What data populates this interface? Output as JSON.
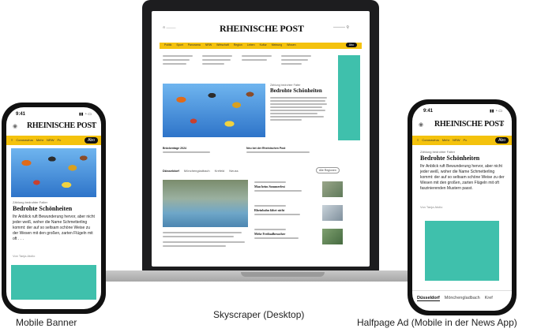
{
  "captions": {
    "left": "Mobile Banner",
    "center": "Skyscraper (Desktop)",
    "right": "Halfpage Ad (Mobile in der News App)"
  },
  "desktop": {
    "logo": "RHEINISCHE POST",
    "nav_items": [
      "Politik",
      "Sport",
      "Panorama",
      "NRW",
      "Wirtschaft",
      "Region",
      "Leben",
      "Kultur",
      "Meinung",
      "Wissen"
    ],
    "nav_pill": "Abo",
    "lead": {
      "kicker": "Zählung bedrohter Falter",
      "headline": "Bedrohte Schönheiten"
    },
    "sub_headlines": [
      "Brückentage 2024",
      "Neu bei der Rheinischen Post"
    ],
    "tabs": [
      "Düsseldorf",
      "Mönchengladbach",
      "Krefeld",
      "Neuss"
    ],
    "tab_button": "Alle Regionen",
    "news": [
      "Mau beim Sommerfest",
      "Rheinbahn fährt nicht",
      "Mehr Freibadbesucher"
    ]
  },
  "mobile_left": {
    "time": "9:41",
    "logo": "RHEINISCHE POST",
    "nav_items": [
      "Coronavirus",
      "Mehr",
      "NRW",
      "Pc"
    ],
    "nav_pill": "Abo",
    "kicker": "Zählung bedrohter Falter",
    "headline": "Bedrohte Schönheiten",
    "body": "Ihr Anblick ruft Bewunderung hervor, aber nicht jeder weiß, woher die Name Schmetterling kommt: der auf so seltsam schöne Weise zu der Wesen mit den großen, zarten Flügeln mit oft . . .",
    "author": "Von Tanja Atolio"
  },
  "mobile_right": {
    "time": "9:41",
    "logo": "RHEINISCHE POST",
    "nav_items": [
      "Coronavirus",
      "Mehr",
      "NRW",
      "Pc"
    ],
    "nav_pill": "Abo",
    "kicker": "Zählung bedrohter Falter",
    "headline": "Bedrohte Schönheiten",
    "body": "Ihr Anblick ruft Bewunderung hervor, aber nicht jeder weiß, woher die Name Schmetterling kommt: der auf so seltsam schöne Weise zu der Wesen mit den großen, zarten Flügeln mit oft faszinierenden Mustern passt.",
    "author": "Von Tanja Atolio",
    "bottom_tabs": [
      "Düsseldorf",
      "Mönchengladbach",
      "Kref"
    ]
  },
  "colors": {
    "nav_yellow": "#f4c20d",
    "ad_teal": "#3fc0ac",
    "device_black": "#1d1d1f"
  }
}
